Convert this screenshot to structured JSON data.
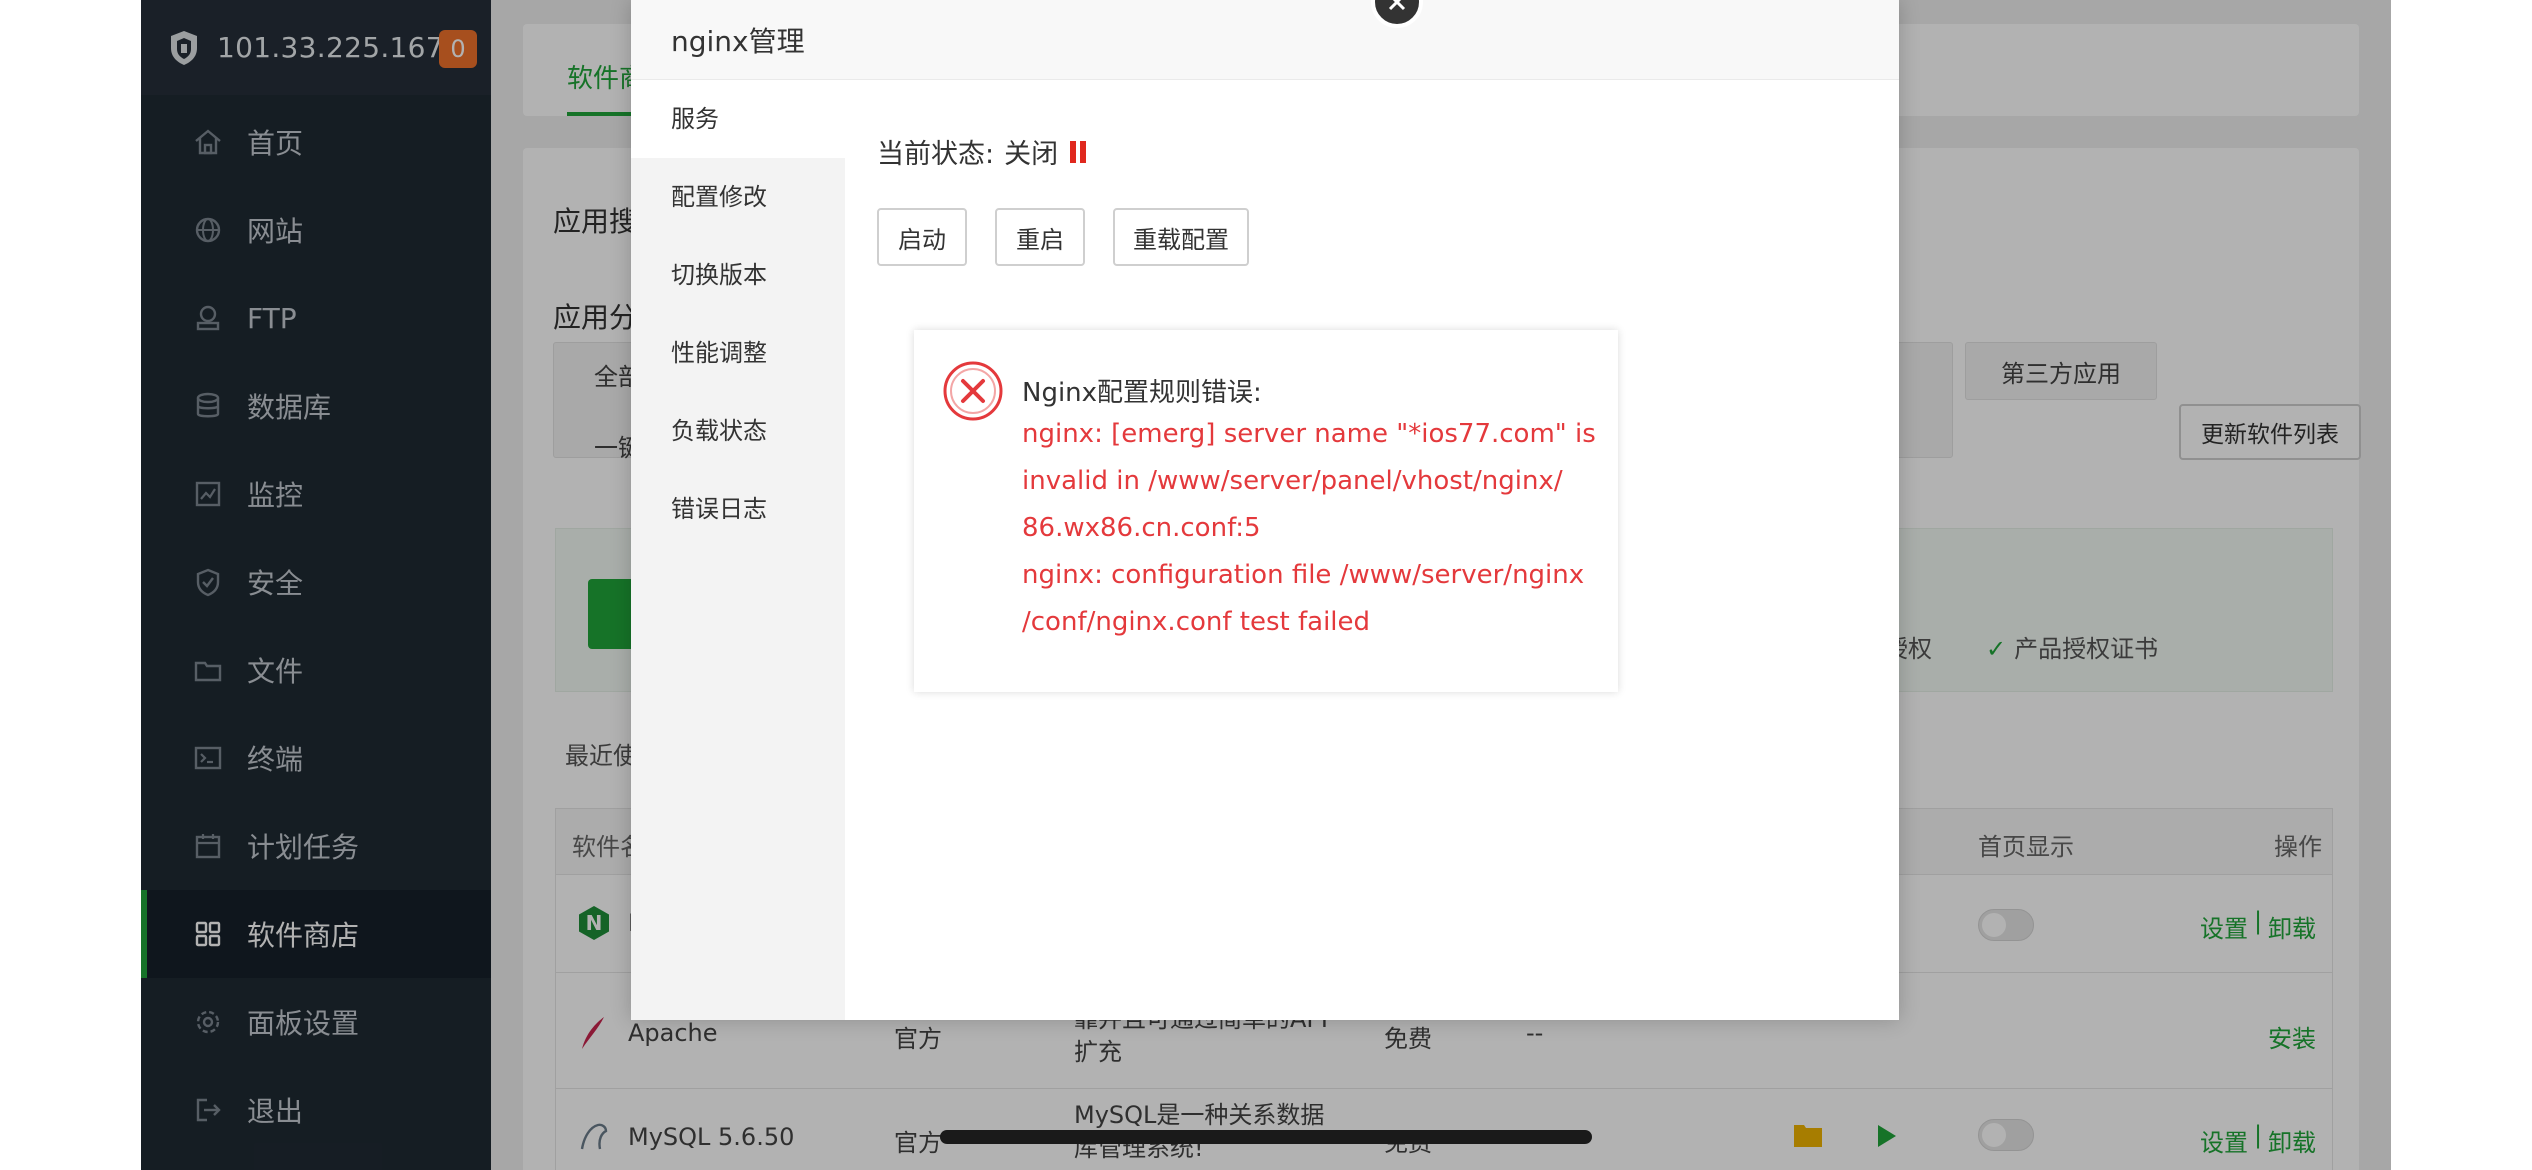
{
  "sidebar": {
    "ip": "101.33.225.167",
    "badge": "0",
    "items": [
      {
        "label": "首页",
        "icon": "home-icon"
      },
      {
        "label": "网站",
        "icon": "globe-icon"
      },
      {
        "label": "FTP",
        "icon": "ftp-icon"
      },
      {
        "label": "数据库",
        "icon": "database-icon"
      },
      {
        "label": "监控",
        "icon": "monitor-icon"
      },
      {
        "label": "安全",
        "icon": "shield-icon"
      },
      {
        "label": "文件",
        "icon": "folder-icon"
      },
      {
        "label": "终端",
        "icon": "terminal-icon"
      },
      {
        "label": "计划任务",
        "icon": "calendar-icon"
      },
      {
        "label": "软件商店",
        "icon": "grid-icon"
      },
      {
        "label": "面板设置",
        "icon": "gear-icon"
      },
      {
        "label": "退出",
        "icon": "logout-icon"
      }
    ]
  },
  "main": {
    "tab_label": "软件商",
    "search_label": "应用搜",
    "category_label": "应用分",
    "cat_all": "全部",
    "cat_oneclick": "一键",
    "cat_third_party": "第三方应用",
    "update_list_button": "更新软件列表",
    "license_text": "授权",
    "license_cert": "产品授权证书",
    "recent_label": "最近使",
    "table": {
      "col_name": "软件名",
      "col_home_display": "首页显示",
      "col_ops": "操作",
      "rows": [
        {
          "name": "N",
          "type": "",
          "desc": "",
          "price": "",
          "expire": "",
          "ops": [
            "设置",
            "卸载"
          ]
        },
        {
          "name": "Apache",
          "type": "官方",
          "desc": "靠并且可通过简单的API扩充",
          "price": "免费",
          "expire": "--",
          "ops": [
            "安装"
          ]
        },
        {
          "name": "MySQL 5.6.50",
          "type": "官方",
          "desc": "MySQL是一种关系数据库管理系统!",
          "price": "免费",
          "expire": "--",
          "ops": [
            "设置",
            "卸载"
          ]
        }
      ]
    }
  },
  "modal": {
    "title": "nginx管理",
    "nav": [
      "服务",
      "配置修改",
      "切换版本",
      "性能调整",
      "负载状态",
      "错误日志"
    ],
    "status_label": "当前状态:",
    "status_value": "关闭",
    "buttons": {
      "start": "启动",
      "restart": "重启",
      "reload": "重载配置"
    }
  },
  "alert": {
    "title": "Nginx配置规则错误:",
    "lines": [
      "nginx: [emerg] server name \"*ios77.com\" is",
      "invalid in /www/server/panel/vhost/nginx/",
      "86.wx86.cn.conf:5",
      "nginx: configuration file /www/server/nginx",
      "/conf/nginx.conf test failed"
    ]
  },
  "colors": {
    "accent": "#20a53a",
    "error": "#e4393c",
    "sidebar_bg": "#1f2a33",
    "badge": "#f0722c"
  }
}
